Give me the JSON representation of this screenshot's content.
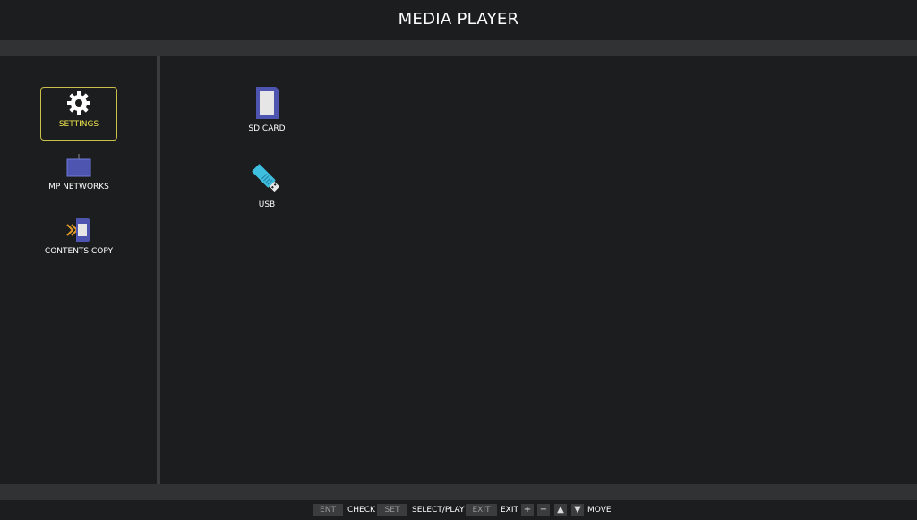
{
  "header": {
    "title": "MEDIA PLAYER"
  },
  "sidebar": {
    "items": [
      {
        "label": "SETTINGS",
        "icon": "gear-icon"
      },
      {
        "label": "MP NETWORKS",
        "icon": "network-icon"
      },
      {
        "label": "CONTENTS COPY",
        "icon": "copy-icon"
      }
    ],
    "selected": "SETTINGS"
  },
  "content": {
    "items": [
      {
        "label": "SD CARD",
        "icon": "sd-card-icon"
      },
      {
        "label": "USB",
        "icon": "usb-icon"
      }
    ]
  },
  "footer": {
    "ent_key": "ENT",
    "ent_action": "CHECK",
    "set_key": "SET",
    "set_action": "SELECT/PLAY",
    "exit_key": "EXIT",
    "exit_action": "EXIT",
    "plus": "+",
    "minus": "−",
    "up": "▲",
    "down": "▼",
    "move_action": "MOVE"
  },
  "colors": {
    "selected": "#f0e64e",
    "background": "#1b1d1e",
    "band": "#303234"
  }
}
